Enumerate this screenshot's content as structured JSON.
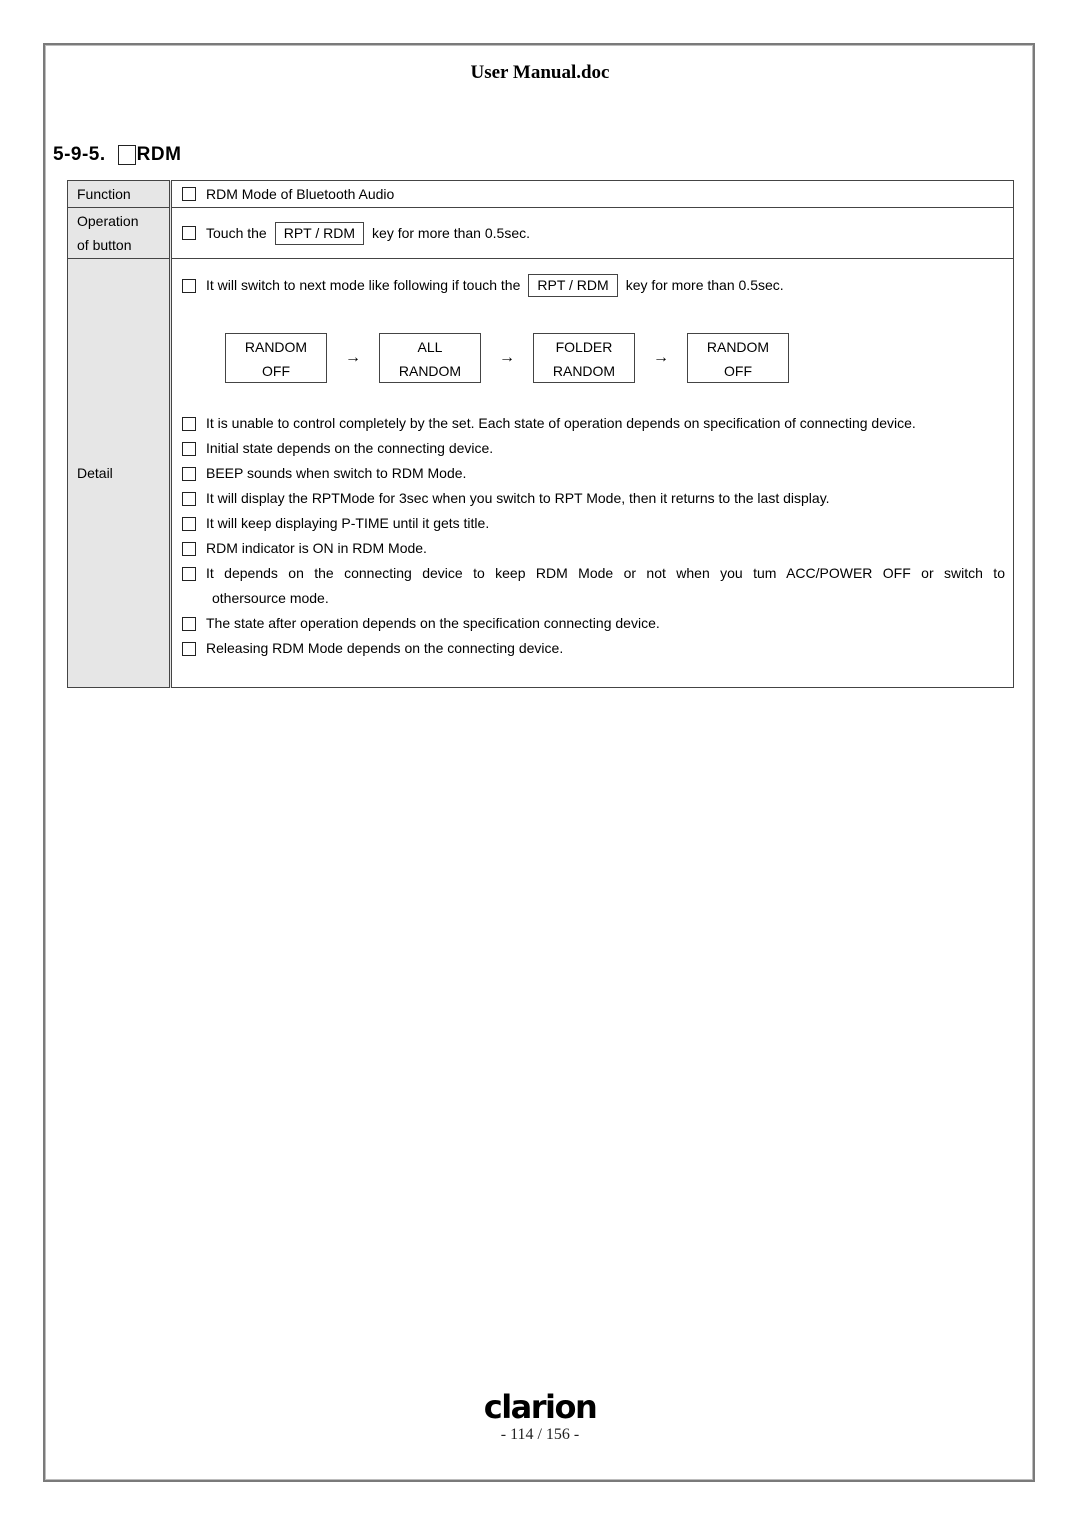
{
  "header": {
    "title": "User Manual.doc"
  },
  "section": {
    "number": "5-9-5.",
    "title": "RDM"
  },
  "table": {
    "function": {
      "label": "Function",
      "text": "RDM Mode of Bluetooth Audio"
    },
    "operation": {
      "label_line1": "Operation",
      "label_line2": "of button",
      "prefix": "Touch the",
      "key": "RPT / RDM",
      "suffix": "key for more than 0.5sec."
    },
    "detail": {
      "label": "Detail",
      "intro": {
        "prefix": "It will switch to next mode like following if touch the",
        "key": "RPT / RDM",
        "suffix": "key for more than 0.5sec."
      },
      "flow": [
        {
          "line1": "RANDOM",
          "line2": "OFF"
        },
        {
          "line1": "ALL",
          "line2": "RANDOM"
        },
        {
          "line1": "FOLDER",
          "line2": "RANDOM"
        },
        {
          "line1": "RANDOM",
          "line2": "OFF"
        }
      ],
      "arrow": "→",
      "notes": [
        "It is unable to control completely by the set. Each state of operation depends on specification of connecting device.",
        "Initial state depends on the connecting device.",
        "BEEP sounds when switch to RDM Mode.",
        "It will display the RPTMode for 3sec when you switch to RPT Mode, then it returns to the last display.",
        "It will keep displaying P-TIME until it gets title.",
        "RDM indicator is ON in RDM Mode.",
        "It depends on the connecting device to keep RDM Mode or not when you tum ACC/POWER OFF or switch to",
        "The state after operation depends on the specification connecting device.",
        "Releasing RDM Mode depends on the connecting device."
      ],
      "note_continuation": "othersource mode."
    }
  },
  "footer": {
    "logo": "clarion",
    "page": "- 114 / 156 -"
  }
}
